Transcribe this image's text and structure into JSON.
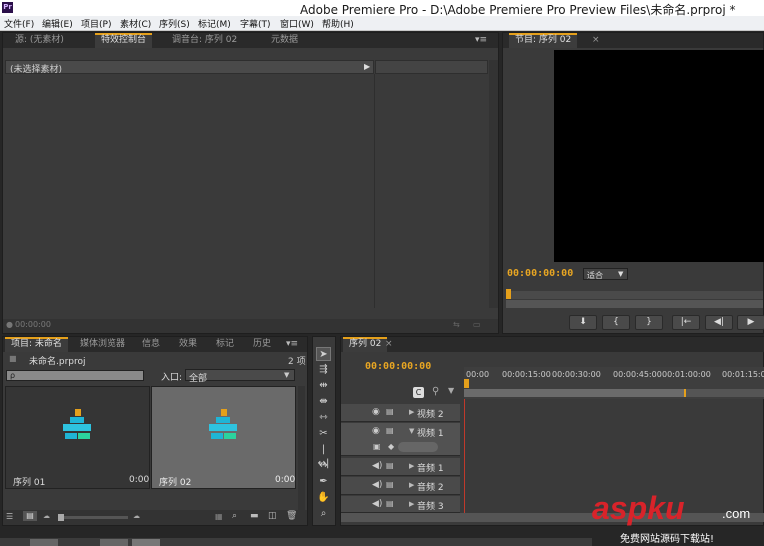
{
  "window": {
    "title": "Adobe Premiere Pro - D:\\Adobe Premiere Pro Preview Files\\未命名.prproj *",
    "app_badge": "Pr"
  },
  "menu": [
    "文件(F)",
    "编辑(E)",
    "项目(P)",
    "素材(C)",
    "序列(S)",
    "标记(M)",
    "字幕(T)",
    "窗口(W)",
    "帮助(H)"
  ],
  "source_panel": {
    "tabs": [
      "源: (无素材)",
      "特效控制台",
      "调音台: 序列 02",
      "元数据"
    ],
    "active_tab": 1,
    "effects_header": "(未选择素材)",
    "footer_time": "00:00:00"
  },
  "program_monitor": {
    "tab": "节目: 序列 02",
    "timecode": "00:00:00:00",
    "fit_option": "适合",
    "buttons": [
      "marker",
      "in",
      "out",
      "go-in",
      "step-back",
      "play"
    ]
  },
  "project_panel": {
    "tabs": [
      "项目: 未命名",
      "媒体浏览器",
      "信息",
      "效果",
      "标记",
      "历史"
    ],
    "project_name": "未命名.prproj",
    "item_count": "2 项",
    "search_placeholder": "ρ",
    "in_label": "入口:",
    "in_value": "全部",
    "items": [
      {
        "name": "序列 01",
        "duration": "0:00",
        "selected": false
      },
      {
        "name": "序列 02",
        "duration": "0:00",
        "selected": true
      }
    ]
  },
  "timeline": {
    "tab": "序列 02",
    "timecode": "00:00:00:00",
    "ruler": [
      "00:00",
      "00:00:15:00",
      "00:00:30:00",
      "00:00:45:00",
      "00:01:00:00",
      "00:01:15:00"
    ],
    "tracks": [
      {
        "name": "视频 2",
        "kind": "video"
      },
      {
        "name": "视频 1",
        "kind": "video"
      },
      {
        "name": "音频 1",
        "kind": "audio"
      },
      {
        "name": "音频 2",
        "kind": "audio"
      },
      {
        "name": "音频 3",
        "kind": "audio"
      }
    ]
  },
  "watermark": {
    "brand": "aspku",
    "tld": ".com",
    "tagline": "免费网站源码下载站!"
  },
  "colors": {
    "accent": "#e5a01b",
    "panel_bg": "#3a3a3a",
    "tabbar_bg": "#2a2a2a",
    "watermark_red": "#d8232a"
  }
}
